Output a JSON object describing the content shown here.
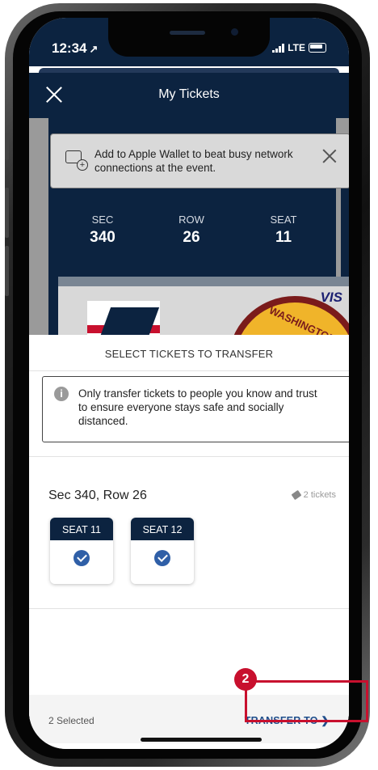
{
  "status_bar": {
    "time": "12:34",
    "location_arrow": "↗",
    "network": "LTE"
  },
  "header": {
    "title": "My Tickets"
  },
  "wallet_banner": {
    "text": "Add to Apple Wallet to beat busy network connections at the event."
  },
  "ticket": {
    "sec_label": "SEC",
    "sec_value": "340",
    "row_label": "ROW",
    "row_value": "26",
    "seat_label": "SEAT",
    "seat_value": "11",
    "logo_text": "WASHINGTON",
    "sponsor": "VIS"
  },
  "sheet": {
    "title": "SELECT TICKETS TO TRANSFER",
    "notice": "Only transfer tickets to people you know and trust to ensure everyone stays safe and socially distanced.",
    "row_title": "Sec 340, Row 26",
    "tickets_count": "2 tickets",
    "seats": [
      {
        "label": "SEAT 11",
        "selected": true
      },
      {
        "label": "SEAT 12",
        "selected": true
      }
    ]
  },
  "footer": {
    "selected": "2 Selected",
    "transfer_label": "TRANSFER TO ❯"
  },
  "annotation": {
    "step": "2"
  },
  "colors": {
    "navy": "#0c2340",
    "accent_blue": "#1f4e8c",
    "highlight_red": "#c8102e"
  }
}
